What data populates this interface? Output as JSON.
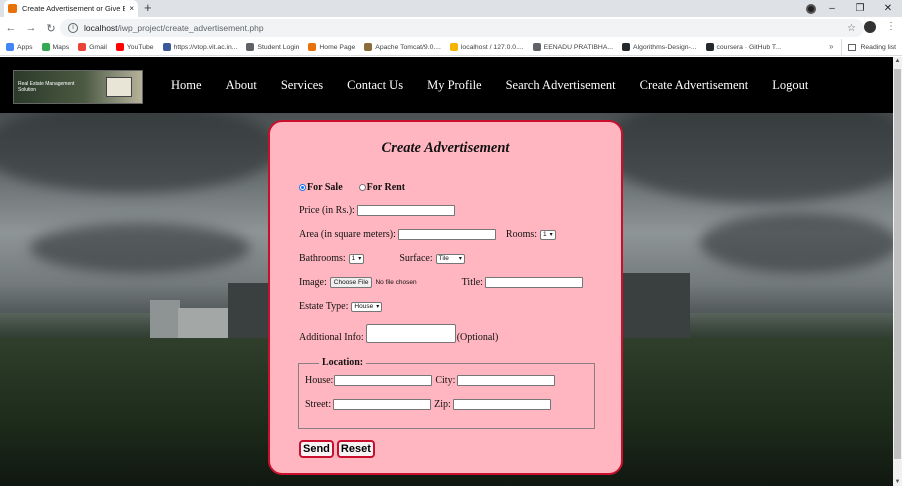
{
  "browser": {
    "tab_title": "Create Advertisement or Give Est",
    "tab_close": "×",
    "new_tab": "+",
    "url_host": "localhost",
    "url_path": "/iwp_project/create_advertisement.php",
    "window_buttons": [
      "–",
      "❐",
      "✕"
    ],
    "bookmarks": [
      {
        "label": "Apps",
        "color": "#4285f4"
      },
      {
        "label": "Maps",
        "color": "#34a853"
      },
      {
        "label": "Gmail",
        "color": "#ea4335"
      },
      {
        "label": "YouTube",
        "color": "#ff0000"
      },
      {
        "label": "https://vtop.vit.ac.in...",
        "color": "#3b5998"
      },
      {
        "label": "Student Login",
        "color": "#5f6368"
      },
      {
        "label": "Home Page",
        "color": "#e8710a"
      },
      {
        "label": "Apache Tomcat/9.0....",
        "color": "#8a6d3b"
      },
      {
        "label": "localhost / 127.0.0....",
        "color": "#f4b400"
      },
      {
        "label": "EENADU PRATIBHA...",
        "color": "#5f6368"
      },
      {
        "label": "Algorithms-Design-...",
        "color": "#24292e"
      },
      {
        "label": "coursera · GitHub T...",
        "color": "#24292e"
      }
    ],
    "bookmarks_more": "»",
    "reading_list": "Reading list"
  },
  "site": {
    "logo_text": "Real Estate Management Solution",
    "menu": [
      "Home",
      "About",
      "Services",
      "Contact Us",
      "My Profile",
      "Search Advertisement",
      "Create Advertisement",
      "Logout"
    ]
  },
  "form": {
    "title": "Create Advertisement",
    "for_sale": "For Sale",
    "for_rent": "For Rent",
    "price_label": "Price (in Rs.):",
    "area_label": "Area (in square meters):",
    "rooms_label": "Rooms:",
    "rooms_value": "1",
    "bathrooms_label": "Bathrooms:",
    "bathrooms_value": "1",
    "surface_label": "Surface:",
    "surface_value": "Tile",
    "image_label": "Image:",
    "choose_file": "Choose File",
    "no_file": "No file chosen",
    "title_label": "Title:",
    "estate_type_label": "Estate Type:",
    "estate_type_value": "House",
    "additional_info_label": "Additional Info:",
    "optional": "(Optional)",
    "location_legend": "Location:",
    "house_label": "House:",
    "city_label": "City:",
    "street_label": "Street:",
    "zip_label": "Zip:",
    "send": "Send",
    "reset": "Reset"
  }
}
